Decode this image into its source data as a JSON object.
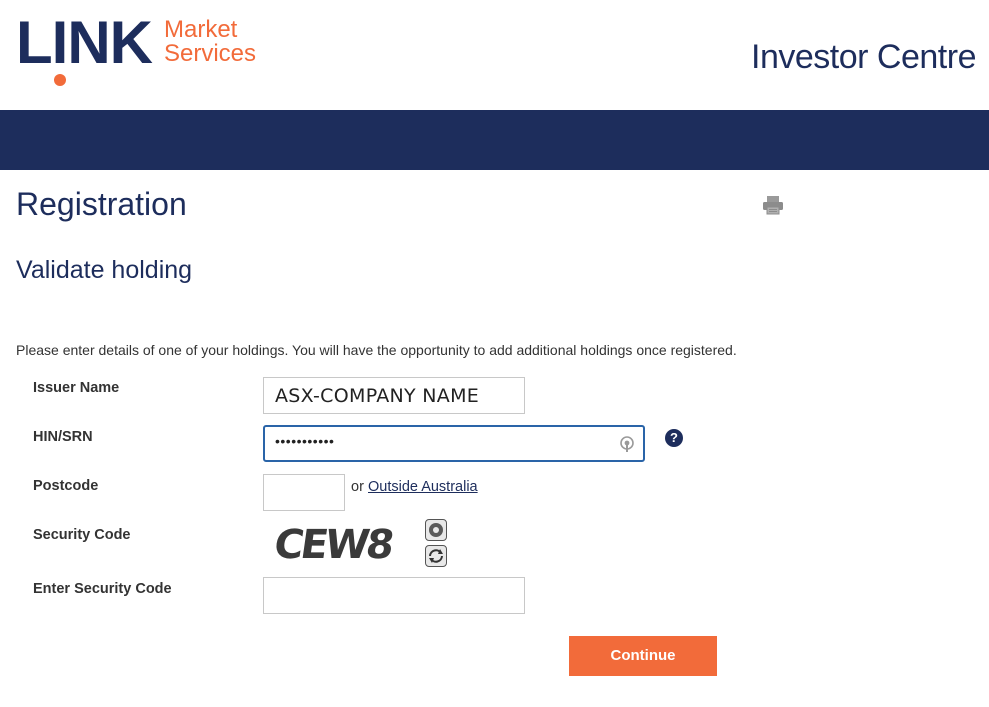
{
  "header": {
    "logo_main": "LINK",
    "logo_sub_line1": "Market",
    "logo_sub_line2": "Services",
    "site_title": "Investor Centre"
  },
  "page": {
    "title": "Registration",
    "section_title": "Validate holding",
    "intro": "Please enter details of one of your holdings. You will have the opportunity to add additional holdings once registered."
  },
  "form": {
    "issuer_label": "Issuer Name",
    "issuer_value": "ASX-COMPANY NAME",
    "hin_label": "HIN/SRN",
    "hin_value": "•••••••••••",
    "help_glyph": "?",
    "postcode_label": "Postcode",
    "postcode_value": "",
    "or_text": "or",
    "outside_link": "Outside Australia",
    "security_label": "Security Code",
    "captcha_text": "CEW8",
    "enter_security_label": "Enter Security Code",
    "enter_security_value": "",
    "continue_label": "Continue"
  },
  "colors": {
    "brand_navy": "#1d2d5c",
    "brand_orange": "#f26b3a",
    "focus_blue": "#2a64a8"
  },
  "icons": {
    "print": "printer-icon",
    "password_reveal": "key-icon",
    "help": "question-mark-icon",
    "audio": "speaker-icon",
    "refresh": "refresh-icon"
  }
}
